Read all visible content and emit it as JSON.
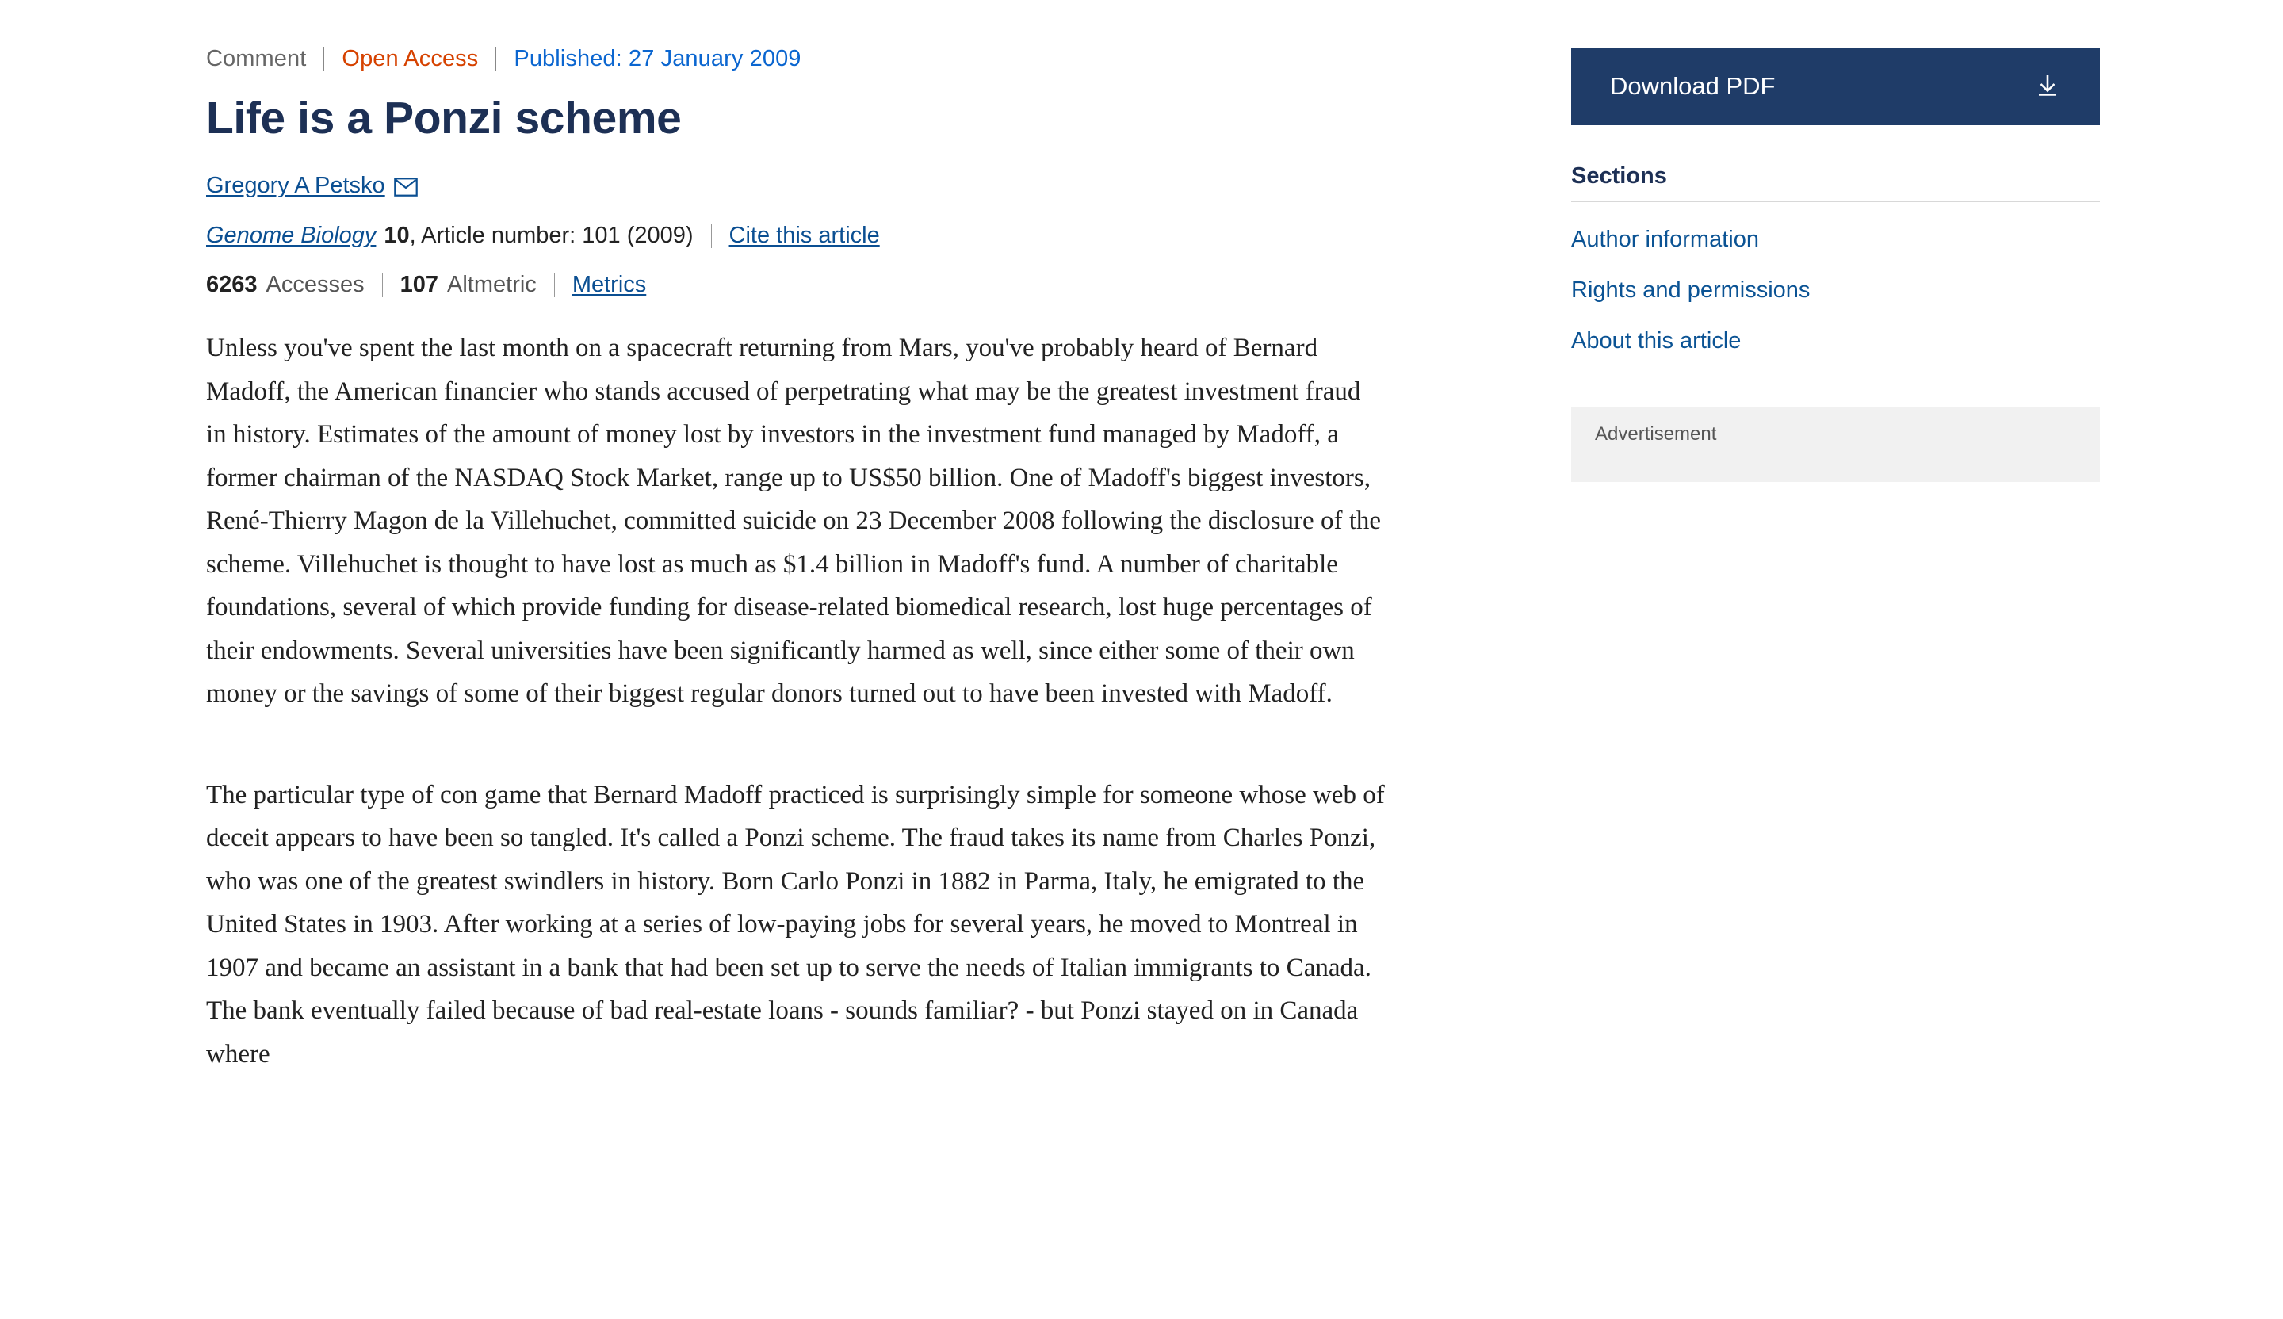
{
  "header": {
    "article_type": "Comment",
    "access_status": "Open Access",
    "published": "Published: 27 January 2009",
    "title": "Life is a Ponzi scheme"
  },
  "author": {
    "name": "Gregory A Petsko",
    "contact_icon": "envelope-icon"
  },
  "citation": {
    "journal": "Genome Biology",
    "volume": "10",
    "rest": ", Article number: 101 (2009)",
    "cite_link": "Cite this article"
  },
  "metrics": {
    "accesses_count": "6263",
    "accesses_label": "Accesses",
    "altmetric_count": "107",
    "altmetric_label": "Altmetric",
    "metrics_link": "Metrics"
  },
  "body": {
    "paragraphs": [
      "Unless you've spent the last month on a spacecraft returning from Mars, you've probably heard of Bernard Madoff, the American financier who stands accused of perpetrating what may be the greatest investment fraud in history. Estimates of the amount of money lost by investors in the investment fund managed by Madoff, a former chairman of the NASDAQ Stock Market, range up to US$50 billion. One of Madoff's biggest investors, René-Thierry Magon de la Villehuchet, committed suicide on 23 December 2008 following the disclosure of the scheme. Villehuchet is thought to have lost as much as $1.4 billion in Madoff's fund. A number of charitable foundations, several of which provide funding for disease-related biomedical research, lost huge percentages of their endowments. Several universities have been significantly harmed as well, since either some of their own money or the savings of some of their biggest regular donors turned out to have been invested with Madoff.",
      "The particular type of con game that Bernard Madoff practiced is surprisingly simple for someone whose web of deceit appears to have been so tangled. It's called a Ponzi scheme. The fraud takes its name from Charles Ponzi, who was one of the greatest swindlers in history. Born Carlo Ponzi in 1882 in Parma, Italy, he emigrated to the United States in 1903. After working at a series of low-paying jobs for several years, he moved to Montreal in 1907 and became an assistant in a bank that had been set up to serve the needs of Italian immigrants to Canada. The bank eventually failed because of bad real-estate loans - sounds familiar? - but Ponzi stayed on in Canada where"
    ]
  },
  "sidebar": {
    "download_label": "Download PDF",
    "download_icon": "download-icon",
    "sections_heading": "Sections",
    "sections": [
      {
        "label": "Author information"
      },
      {
        "label": "Rights and permissions"
      },
      {
        "label": "About this article"
      }
    ],
    "advertisement_label": "Advertisement"
  },
  "colors": {
    "title_navy": "#1d3055",
    "open_access_orange": "#d64200",
    "link_blue": "#0b4f92",
    "published_blue": "#0b66d0",
    "button_navy": "#1f3c68",
    "ad_bg": "#f1f1f1"
  }
}
